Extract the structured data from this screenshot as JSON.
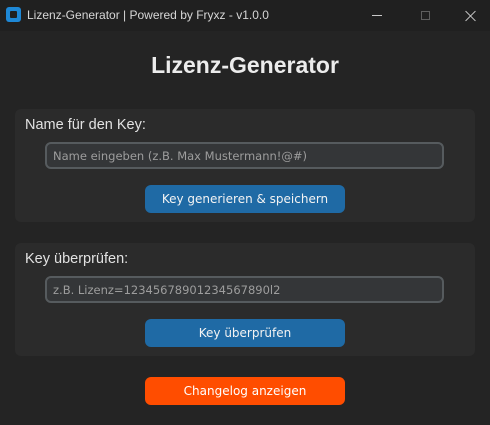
{
  "window": {
    "title": "Lizenz-Generator | Powered by Fryxz - v1.0.0",
    "icon": "app-icon",
    "controls": [
      "minimize-icon",
      "maximize-icon",
      "close-icon"
    ]
  },
  "main": {
    "heading": "Lizenz-Generator"
  },
  "generate_section": {
    "label": "Name für den Key:",
    "input_value": "",
    "input_placeholder": "Name eingeben (z.B. Max Mustermann!@#)",
    "button_label": "Key generieren & speichern"
  },
  "verify_section": {
    "label": "Key überprüfen:",
    "input_value": "",
    "input_placeholder": "z.B. Lizenz=12345678901234567890l2",
    "button_label": "Key überprüfen"
  },
  "footer": {
    "changelog_label": "Changelog anzeigen"
  },
  "colors": {
    "background": "#242424",
    "card": "#2b2b2b",
    "primary_button": "#1f6aa5",
    "changelog_button": "#ff4d00"
  }
}
